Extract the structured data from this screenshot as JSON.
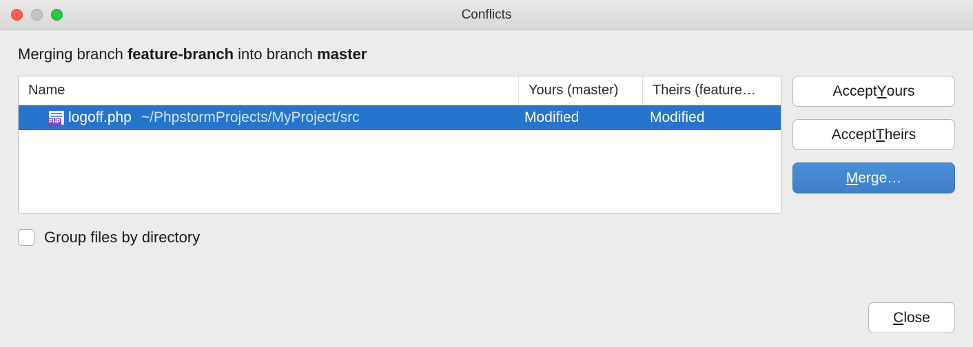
{
  "titlebar": {
    "title": "Conflicts"
  },
  "heading": {
    "prefix": "Merging branch ",
    "source_branch": "feature-branch",
    "mid": " into branch ",
    "target_branch": "master"
  },
  "table": {
    "headers": {
      "name": "Name",
      "yours": "Yours (master)",
      "theirs": "Theirs (feature…"
    },
    "rows": [
      {
        "icon": "php-file-icon",
        "filename": "logoff.php",
        "filepath": "~/PhpstormProjects/MyProject/src",
        "yours": "Modified",
        "theirs": "Modified"
      }
    ]
  },
  "buttons": {
    "accept_yours_pre": "Accept ",
    "accept_yours_mn": "Y",
    "accept_yours_post": "ours",
    "accept_theirs_pre": "Accept ",
    "accept_theirs_mn": "T",
    "accept_theirs_post": "heirs",
    "merge_mn": "M",
    "merge_post": "erge…",
    "close_mn": "C",
    "close_post": "lose"
  },
  "checkbox": {
    "label": "Group files by directory",
    "checked": false
  }
}
